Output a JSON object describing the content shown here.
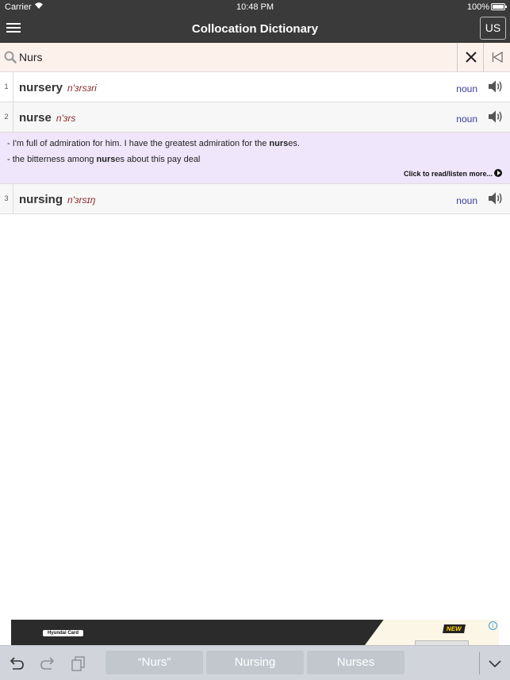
{
  "status_bar": {
    "carrier": "Carrier",
    "time": "10:48 PM",
    "battery": "100%"
  },
  "nav": {
    "title": "Collocation Dictionary",
    "region_label": "US"
  },
  "search": {
    "value": "Nurs"
  },
  "results": [
    {
      "num": "1",
      "word": "nursery",
      "pron": "n'ɜrsɜri",
      "pos": "noun"
    },
    {
      "num": "2",
      "word": "nurse",
      "pron": "n'ɜrs",
      "pos": "noun"
    },
    {
      "num": "3",
      "word": "nursing",
      "pron": "n'ɜrsɪŋ",
      "pos": "noun"
    }
  ],
  "examples": {
    "line1_pre": "- I'm full of admiration for him. I have the greatest admiration for the ",
    "line1_bold": "nurs",
    "line1_post": "es.",
    "line2_pre": "- the bitterness among ",
    "line2_bold": "nurs",
    "line2_post": "es about this pay deal",
    "more": "Click to read/listen more..."
  },
  "ad": {
    "logo": "Hyundai Card",
    "badge": "NEW",
    "info": "i"
  },
  "keyboard": {
    "suggestions": [
      "“Nurs”",
      "Nursing",
      "Nurses"
    ]
  },
  "colors": {
    "bar_bg": "#3a3a3a",
    "search_bg": "#fdf1ec",
    "example_bg": "#efe6fb",
    "pron_color": "#8b2a2a",
    "pos_color": "#3a3aa0"
  }
}
